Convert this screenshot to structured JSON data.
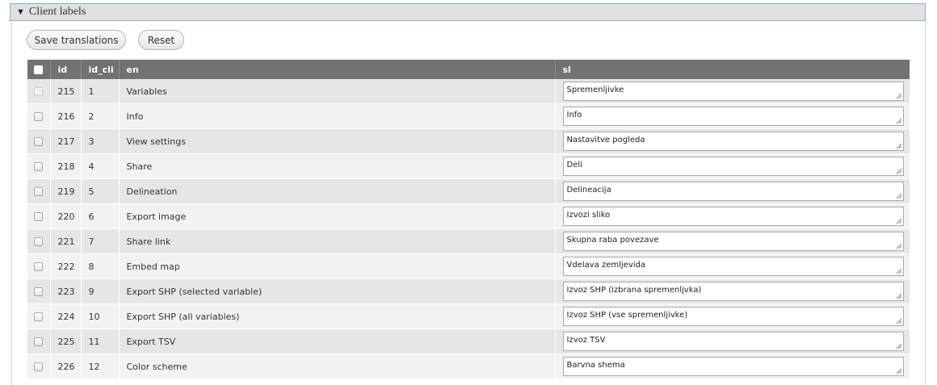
{
  "section": {
    "title": "Client labels",
    "toggle_icon": "triangle-down-icon"
  },
  "toolbar": {
    "save_label": "Save translations",
    "reset_label": "Reset"
  },
  "table": {
    "columns": [
      "id",
      "id_cli",
      "en",
      "sl"
    ],
    "rows": [
      {
        "id": "215",
        "id_cli": "1",
        "en": "Variables",
        "sl": "Spremenljivke"
      },
      {
        "id": "216",
        "id_cli": "2",
        "en": "Info",
        "sl": "Info"
      },
      {
        "id": "217",
        "id_cli": "3",
        "en": "View settings",
        "sl": "Nastavitve pogleda"
      },
      {
        "id": "218",
        "id_cli": "4",
        "en": "Share",
        "sl": "Deli"
      },
      {
        "id": "219",
        "id_cli": "5",
        "en": "Delineation",
        "sl": "Delineacija"
      },
      {
        "id": "220",
        "id_cli": "6",
        "en": "Export image",
        "sl": "Izvozi sliko"
      },
      {
        "id": "221",
        "id_cli": "7",
        "en": "Share link",
        "sl": "Skupna raba povezave"
      },
      {
        "id": "222",
        "id_cli": "8",
        "en": "Embed map",
        "sl": "Vdelava zemljevida"
      },
      {
        "id": "223",
        "id_cli": "9",
        "en": "Export SHP (selected variable)",
        "sl": "Izvoz SHP (izbrana spremenljvka)"
      },
      {
        "id": "224",
        "id_cli": "10",
        "en": "Export SHP (all variables)",
        "sl": "Izvoz SHP (vse spremenljivke)"
      },
      {
        "id": "225",
        "id_cli": "11",
        "en": "Export TSV",
        "sl": "Izvoz TSV"
      },
      {
        "id": "226",
        "id_cli": "12",
        "en": "Color scheme",
        "sl": "Barvna shema"
      }
    ]
  }
}
